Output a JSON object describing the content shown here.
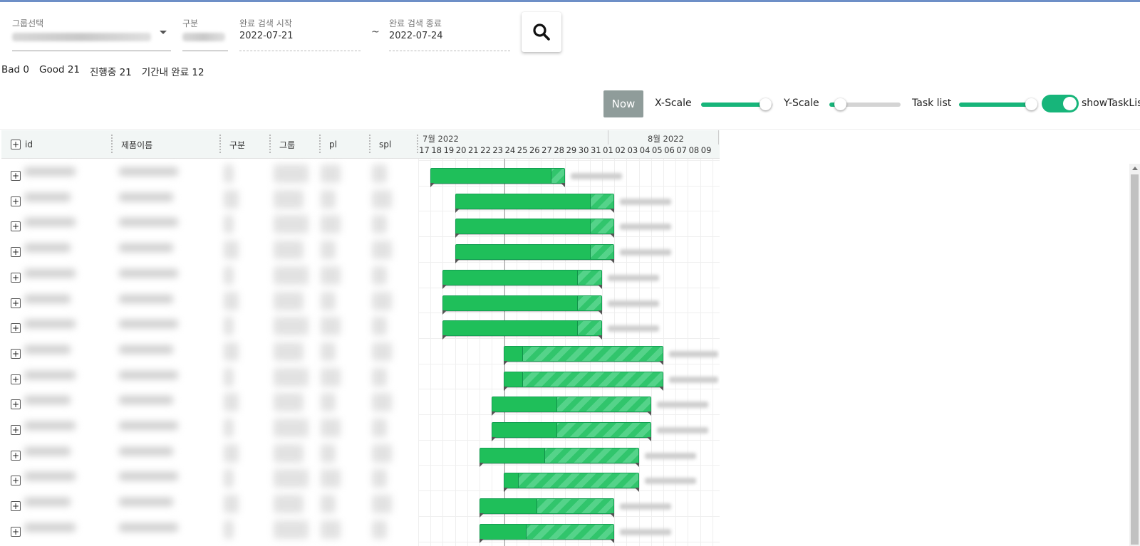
{
  "filters": {
    "group_select": {
      "label": "그룹선택"
    },
    "category": {
      "label": "구분"
    },
    "search_start": {
      "label": "완료 검색 시작",
      "value": "2022-07-21"
    },
    "range_separator": "~",
    "search_end": {
      "label": "완료 검색 종료",
      "value": "2022-07-24"
    },
    "search_icon": "search-icon"
  },
  "stats": {
    "bad": "Bad 0",
    "good": "Good 21",
    "in_progress": "진행중 21",
    "completed_in_period": "기간내 완료 12"
  },
  "controls": {
    "now_label": "Now",
    "x_scale_label": "X-Scale",
    "x_scale_level": 0.9,
    "y_scale_label": "Y-Scale",
    "y_scale_level": 0.15,
    "task_list_label": "Task list",
    "task_list_level": 0.95,
    "show_task_list_label": "showTaskList",
    "show_task_list": true
  },
  "task_list": {
    "columns": [
      "id",
      "제품이름",
      "구분",
      "그룹",
      "pl",
      "spl"
    ],
    "expand_symbol": "+"
  },
  "calendar": {
    "months": [
      "7월 2022",
      "8월 2022"
    ],
    "days": [
      "17",
      "18",
      "19",
      "20",
      "21",
      "22",
      "23",
      "24",
      "25",
      "26",
      "27",
      "28",
      "29",
      "30",
      "31",
      "01",
      "02",
      "03",
      "04",
      "05",
      "06",
      "07",
      "08",
      "09"
    ],
    "today": "2022-07-24"
  },
  "tasks": [
    {
      "start": "2022-07-18",
      "end": "2022-07-28",
      "progress": 0.9
    },
    {
      "start": "2022-07-20",
      "end": "2022-08-01",
      "progress": 0.85
    },
    {
      "start": "2022-07-20",
      "end": "2022-08-01",
      "progress": 0.85
    },
    {
      "start": "2022-07-20",
      "end": "2022-08-01",
      "progress": 0.85
    },
    {
      "start": "2022-07-19",
      "end": "2022-07-31",
      "progress": 0.85
    },
    {
      "start": "2022-07-19",
      "end": "2022-07-31",
      "progress": 0.85
    },
    {
      "start": "2022-07-19",
      "end": "2022-07-31",
      "progress": 0.85
    },
    {
      "start": "2022-07-24",
      "end": "2022-08-05",
      "progress": 0.12
    },
    {
      "start": "2022-07-24",
      "end": "2022-08-05",
      "progress": 0.12
    },
    {
      "start": "2022-07-23",
      "end": "2022-08-04",
      "progress": 0.41
    },
    {
      "start": "2022-07-23",
      "end": "2022-08-04",
      "progress": 0.41
    },
    {
      "start": "2022-07-22",
      "end": "2022-08-03",
      "progress": 0.41
    },
    {
      "start": "2022-07-24",
      "end": "2022-08-03",
      "progress": 0.11
    },
    {
      "start": "2022-07-22",
      "end": "2022-08-01",
      "progress": 0.43
    },
    {
      "start": "2022-07-22",
      "end": "2022-08-01",
      "progress": 0.35
    }
  ]
}
